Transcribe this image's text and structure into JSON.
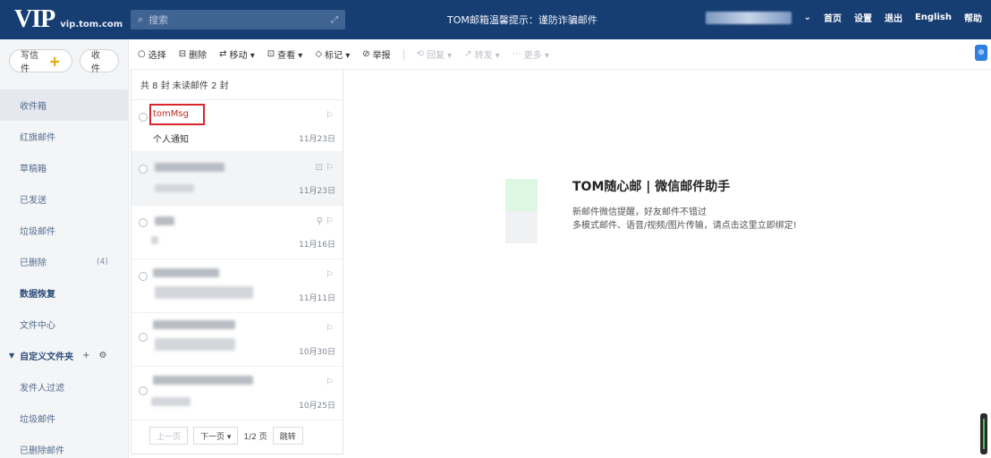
{
  "header": {
    "logo": "VIP",
    "domain": "vip.tom.com",
    "search_placeholder": "搜索",
    "notice": "TOM邮箱温馨提示：谨防诈骗邮件",
    "links": [
      "首页",
      "设置",
      "退出",
      "English",
      "帮助"
    ]
  },
  "sidebar": {
    "compose_label": "写信件",
    "receive_label": "收件",
    "items": [
      {
        "label": "收件箱"
      },
      {
        "label": "红旗邮件"
      },
      {
        "label": "草稿箱"
      },
      {
        "label": "已发送"
      },
      {
        "label": "垃圾邮件"
      },
      {
        "label": "已删除",
        "badge": "(4)"
      },
      {
        "label": "数据恢复"
      },
      {
        "label": "文件中心"
      }
    ],
    "group": {
      "label": "自定义文件夹",
      "add": "+",
      "settings": "⚙"
    },
    "group_items": [
      {
        "label": "发件人过滤"
      },
      {
        "label": "垃圾邮件"
      },
      {
        "label": "已删除邮件"
      }
    ]
  },
  "toolbar": {
    "items": [
      {
        "label": "选择",
        "icon": "○"
      },
      {
        "label": "删除",
        "icon": "⊟"
      },
      {
        "label": "移动 ▾",
        "icon": "⇄"
      },
      {
        "label": "查看 ▾",
        "icon": "⊡"
      },
      {
        "label": "标记 ▾",
        "icon": "◇"
      },
      {
        "label": "举报",
        "icon": "⊘"
      }
    ],
    "disabled_items": [
      {
        "label": "回复 ▾",
        "icon": "⟲"
      },
      {
        "label": "转发 ▾",
        "icon": "↗"
      },
      {
        "label": "更多 ▾",
        "icon": "⋯"
      }
    ]
  },
  "mail_list": {
    "summary": "共 8 封   未读邮件 2 封",
    "mails": [
      {
        "sender": "tomMsg",
        "subject": "个人通知",
        "date": "11月23日"
      },
      {
        "sender": "",
        "subject": "",
        "date": "11月23日"
      },
      {
        "sender": "",
        "subject": "",
        "date": "11月16日"
      },
      {
        "sender": "",
        "subject": "",
        "date": "11月11日"
      },
      {
        "sender": "",
        "subject": "",
        "date": "10月30日"
      },
      {
        "sender": "",
        "subject": "",
        "date": "10月25日"
      }
    ],
    "pager": {
      "prev": "上一页",
      "next": "下一页 ▾",
      "page": "1/2 页",
      "jump": "跳转"
    }
  },
  "reading_pane": {
    "title": "TOM随心邮 | 微信邮件助手",
    "line1": "新邮件微信提醒，好友邮件不错过",
    "line2": "多模式邮件、语音/视频/图片传输，请点击这里立即绑定!"
  }
}
